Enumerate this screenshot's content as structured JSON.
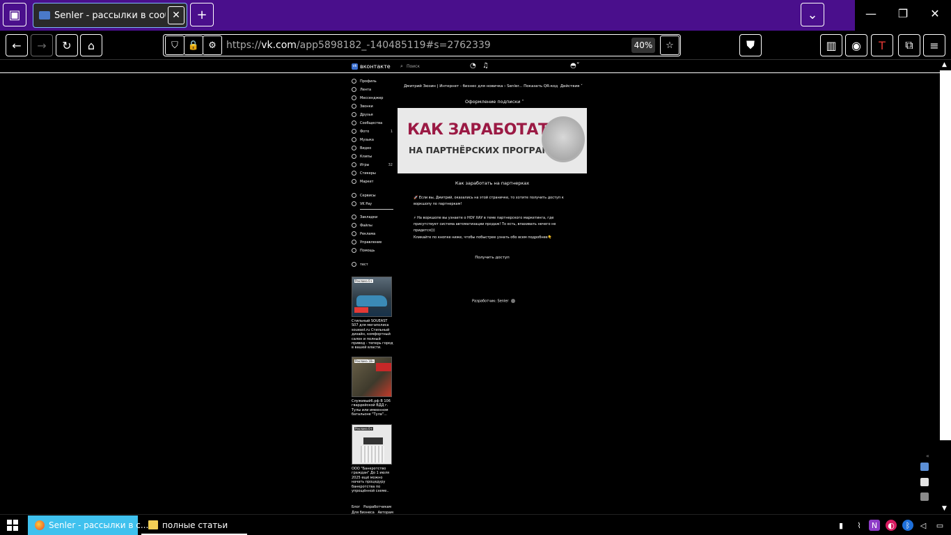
{
  "browser": {
    "tab": {
      "title": "Senler - рассылки в сообщест"
    },
    "url": {
      "prefix": "https://",
      "domain": "vk.com",
      "path": "/app5898182_-140485119#s=2762339"
    },
    "zoom": "40%"
  },
  "vk": {
    "brand": "вконтакте",
    "search_placeholder": "Поиск",
    "sidebar": [
      {
        "label": "Профиль",
        "count": ""
      },
      {
        "label": "Лента",
        "count": ""
      },
      {
        "label": "Мессенджер",
        "count": ""
      },
      {
        "label": "Звонки",
        "count": ""
      },
      {
        "label": "Друзья",
        "count": ""
      },
      {
        "label": "Сообщества",
        "count": ""
      },
      {
        "label": "Фото",
        "count": "1"
      },
      {
        "label": "Музыка",
        "count": ""
      },
      {
        "label": "Видео",
        "count": ""
      },
      {
        "label": "Клипы",
        "count": ""
      },
      {
        "label": "Игры",
        "count": "32"
      },
      {
        "label": "Стикеры",
        "count": ""
      },
      {
        "label": "Маркет",
        "count": ""
      }
    ],
    "sidebar2": [
      "Сервисы",
      "VK Pay"
    ],
    "sidebar3": [
      "Закладки",
      "Файлы",
      "Реклама",
      "Управление",
      "Помощь"
    ],
    "sidebar4": [
      "тест"
    ],
    "ads": [
      {
        "badge": "Реклама 0+",
        "text": "Стильный SOUEAST S07 для мегаполиса soueast.ru Стильный дизайн, комфортный салон и полный привод - теперь город в вашей власти."
      },
      {
        "badge": "Реклама 18+",
        "text": "Служивый6.рф В 106 гвардейской ВДД г. Тулы или имеенном батальоне \"Тула\"..."
      },
      {
        "badge": "Реклама 0+",
        "text": "ООО \"Банкротство граждан\" До 1 июля 2025 ещё можно начать процедуру банкротства по упрощённой схеме.."
      }
    ],
    "footer": [
      "Блог",
      "Разработчикам",
      "Для бизнеса",
      "Авторам"
    ]
  },
  "app": {
    "breadcrumb": "Дмитрий Зюзин | Интернет - бизнес для новичка  ›  Senler...",
    "qr": "Показать QR-код",
    "actions": "Действия ˅",
    "subscription_dropdown": "Оформление подписки",
    "banner_line1": "КАК ЗАРАБОТАТЬ",
    "banner_line2": "НА ПАРТНЁРСКИХ ПРОГРАММАХ",
    "subscription_title": "Как заработать на партнерках",
    "paragraphs": [
      "🚀 Если вы, Дмитрий, оказались на этой страничке, то хотите получить доступ к воркшопу по партнеркам!",
      "⚡ На воркшопе вы узнаете о НОУ ХАУ в теме партнерского маркетинга, где присутствует система автоматизации продаж! То есть, впахивать нечего не придется)))",
      "Кликайте по кнопке ниже, чтобы побыстрее узнать обо всем подробнее👇"
    ],
    "access_button": "Получить доступ",
    "developer": "Разработчик: Senler"
  },
  "taskbar": {
    "apps": [
      {
        "label": "Senler - рассылки в с..."
      },
      {
        "label": "полные статьи"
      }
    ]
  }
}
